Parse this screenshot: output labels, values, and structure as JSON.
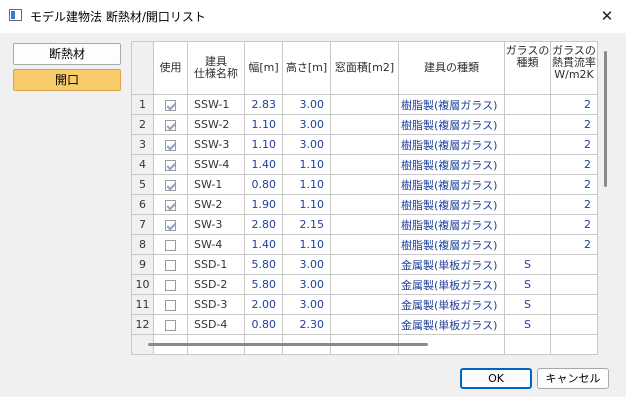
{
  "window": {
    "title": "モデル建物法 断熱材/開口リスト",
    "close_glyph": "✕"
  },
  "sidebar": {
    "items": [
      {
        "label": "断熱材",
        "active": false
      },
      {
        "label": "開口",
        "active": true
      }
    ]
  },
  "table": {
    "headers": {
      "use": "使用",
      "spec_line1": "建具",
      "spec_line2": "仕様名称",
      "width": "幅[m]",
      "height": "高さ[m]",
      "area": "窓面積[m2]",
      "kind": "建具の種類",
      "glass_line1": "ガラスの",
      "glass_line2": "種類",
      "heat_line1": "ガラスの",
      "heat_line2": "熱貫流率",
      "heat_line3": "W/m2K"
    },
    "rows": [
      {
        "no": "1",
        "checked": true,
        "name": "SSW-1",
        "width": "2.83",
        "height": "3.00",
        "area": "",
        "kind": "樹脂製(複層ガラス)",
        "glass": "",
        "heat": "2"
      },
      {
        "no": "2",
        "checked": true,
        "name": "SSW-2",
        "width": "1.10",
        "height": "3.00",
        "area": "",
        "kind": "樹脂製(複層ガラス)",
        "glass": "",
        "heat": "2"
      },
      {
        "no": "3",
        "checked": true,
        "name": "SSW-3",
        "width": "1.10",
        "height": "3.00",
        "area": "",
        "kind": "樹脂製(複層ガラス)",
        "glass": "",
        "heat": "2"
      },
      {
        "no": "4",
        "checked": true,
        "name": "SSW-4",
        "width": "1.40",
        "height": "1.10",
        "area": "",
        "kind": "樹脂製(複層ガラス)",
        "glass": "",
        "heat": "2"
      },
      {
        "no": "5",
        "checked": true,
        "name": "SW-1",
        "width": "0.80",
        "height": "1.10",
        "area": "",
        "kind": "樹脂製(複層ガラス)",
        "glass": "",
        "heat": "2"
      },
      {
        "no": "6",
        "checked": true,
        "name": "SW-2",
        "width": "1.90",
        "height": "1.10",
        "area": "",
        "kind": "樹脂製(複層ガラス)",
        "glass": "",
        "heat": "2"
      },
      {
        "no": "7",
        "checked": true,
        "name": "SW-3",
        "width": "2.80",
        "height": "2.15",
        "area": "",
        "kind": "樹脂製(複層ガラス)",
        "glass": "",
        "heat": "2"
      },
      {
        "no": "8",
        "checked": false,
        "name": "SW-4",
        "width": "1.40",
        "height": "1.10",
        "area": "",
        "kind": "樹脂製(複層ガラス)",
        "glass": "",
        "heat": "2"
      },
      {
        "no": "9",
        "checked": false,
        "name": "SSD-1",
        "width": "5.80",
        "height": "3.00",
        "area": "",
        "kind": "金属製(単板ガラス)",
        "glass": "S",
        "heat": ""
      },
      {
        "no": "10",
        "checked": false,
        "name": "SSD-2",
        "width": "5.80",
        "height": "3.00",
        "area": "",
        "kind": "金属製(単板ガラス)",
        "glass": "S",
        "heat": ""
      },
      {
        "no": "11",
        "checked": false,
        "name": "SSD-3",
        "width": "2.00",
        "height": "3.00",
        "area": "",
        "kind": "金属製(単板ガラス)",
        "glass": "S",
        "heat": ""
      },
      {
        "no": "12",
        "checked": false,
        "name": "SSD-4",
        "width": "0.80",
        "height": "2.30",
        "area": "",
        "kind": "金属製(単板ガラス)",
        "glass": "S",
        "heat": ""
      }
    ]
  },
  "buttons": {
    "ok": "OK",
    "cancel": "キャンセル"
  }
}
